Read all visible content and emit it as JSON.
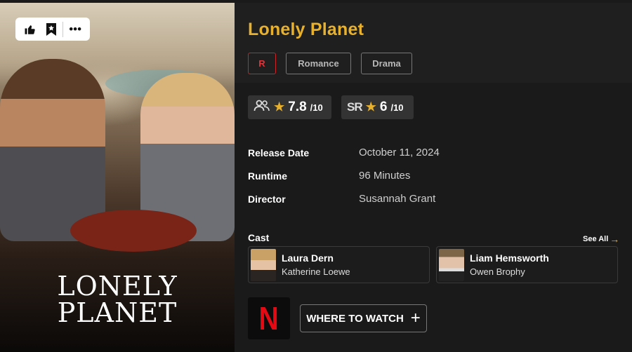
{
  "poster": {
    "title_line1": "LONELY",
    "title_line2": "PLANET",
    "actions": {
      "like_icon": "thumbs-up-icon",
      "watchlist_icon": "bookmark-star-icon",
      "more_icon": "more-dots-icon",
      "more_label": "•••"
    }
  },
  "movie": {
    "title": "Lonely Planet",
    "rating": "R",
    "genres": [
      "Romance",
      "Drama"
    ]
  },
  "scores": {
    "audience": {
      "icon": "audience-users-icon",
      "value": "7.8",
      "scale": "/10"
    },
    "site": {
      "icon": "sr-logo",
      "logo_text": "SR",
      "value": "6",
      "scale": "/10"
    }
  },
  "info": [
    {
      "label": "Release Date",
      "value": "October 11, 2024"
    },
    {
      "label": "Runtime",
      "value": "96 Minutes"
    },
    {
      "label": "Director",
      "value": "Susannah Grant"
    }
  ],
  "cast": {
    "heading": "Cast",
    "see_all": "See All",
    "members": [
      {
        "name": "Laura Dern",
        "role": "Katherine Loewe"
      },
      {
        "name": "Liam Hemsworth",
        "role": "Owen Brophy"
      }
    ]
  },
  "watch": {
    "provider_logo": "N",
    "button_label": "WHERE TO WATCH",
    "button_icon": "plus-icon"
  },
  "colors": {
    "accent": "#e8b12d",
    "rating_red": "#e0353a",
    "netflix_red": "#e50914"
  }
}
